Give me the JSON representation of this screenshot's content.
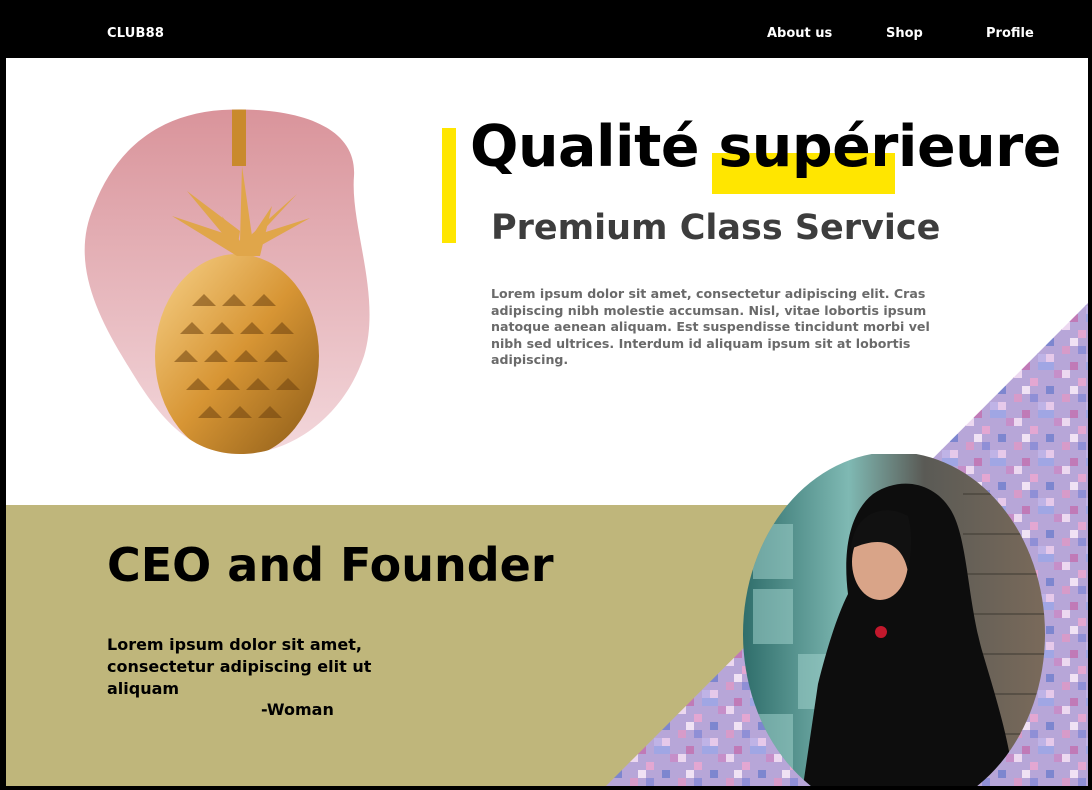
{
  "nav": {
    "brand": "CLUB88",
    "links": [
      "About us",
      "Shop",
      "Profile"
    ]
  },
  "hero": {
    "headline_part1": "Qualité ",
    "headline_part2": "supérieure",
    "subheadline": "Premium Class Service",
    "body": "Lorem ipsum dolor sit amet, consectetur adipiscing elit. Cras adipiscing nibh molestie accumsan. Nisl, vitae lobortis ipsum natoque aenean aliquam. Est suspendisse tincidunt morbi vel nibh sed ultrices. Interdum id aliquam ipsum sit at lobortis adipiscing."
  },
  "founder": {
    "title": "CEO and Founder",
    "quote": "Lorem ipsum dolor sit amet, consectetur adipiscing elit ut aliquam",
    "author": "-Woman"
  },
  "colors": {
    "accent_yellow": "#ffe600",
    "olive": "#bfb67b",
    "nav_bg": "#000000"
  },
  "images": {
    "hero_image": "golden-pineapple-photo",
    "founder_image": "woman-portrait-photo",
    "decoration": "pixel-mosaic-pattern"
  }
}
